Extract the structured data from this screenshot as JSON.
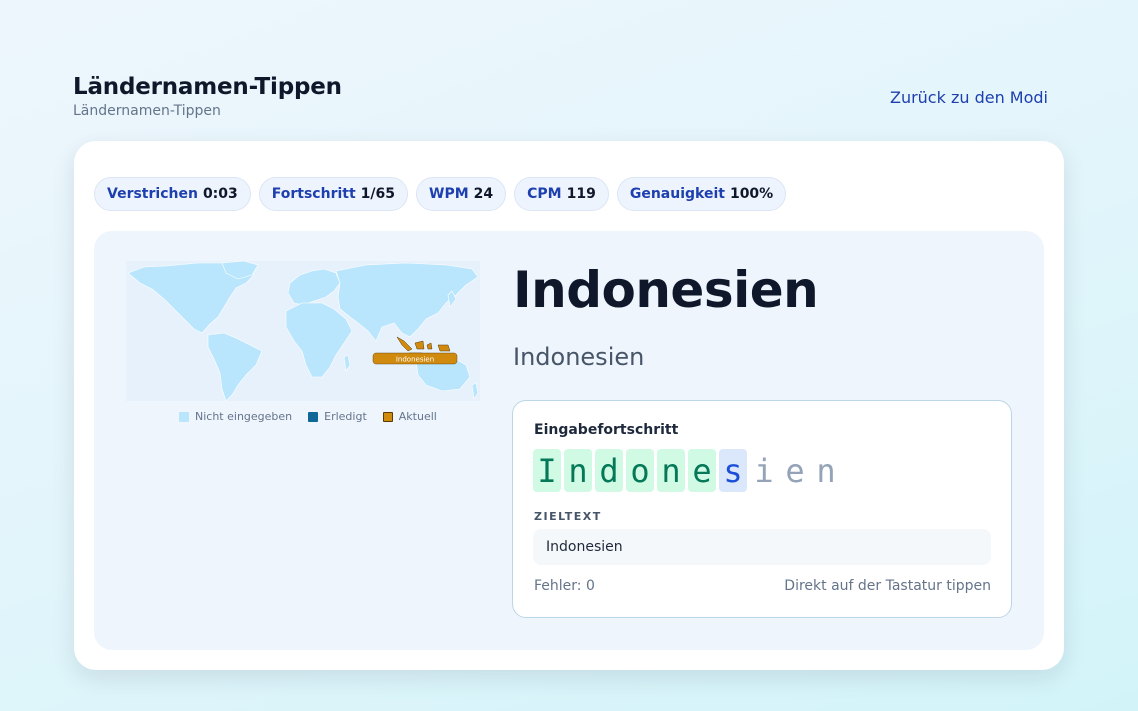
{
  "header": {
    "title": "Ländernamen-Tippen",
    "subtitle": "Ländernamen-Tippen",
    "back_link": "Zurück zu den Modi"
  },
  "stats": [
    {
      "label": "Verstrichen",
      "value": "0:03"
    },
    {
      "label": "Fortschritt",
      "value": "1/65"
    },
    {
      "label": "WPM",
      "value": "24"
    },
    {
      "label": "CPM",
      "value": "119"
    },
    {
      "label": "Genauigkeit",
      "value": "100%"
    }
  ],
  "map": {
    "highlight_label": "Indonesien",
    "legend": {
      "not_entered": "Nicht eingegeben",
      "done": "Erledigt",
      "current": "Aktuell"
    },
    "colors": {
      "not_entered": "#bae6fd",
      "done": "#0e6797",
      "current": "#d08a0e"
    }
  },
  "country": {
    "name": "Indonesien",
    "subtitle": "Indonesien"
  },
  "input": {
    "label": "Eingabefortschritt",
    "chars": [
      "I",
      "n",
      "d",
      "o",
      "n",
      "e",
      "s",
      "i",
      "e",
      "n"
    ],
    "typed_count": 6,
    "target_label": "ZIELTEXT",
    "target_text": "Indonesien",
    "errors": "Fehler: 0",
    "hint": "Direkt auf der Tastatur tippen"
  }
}
